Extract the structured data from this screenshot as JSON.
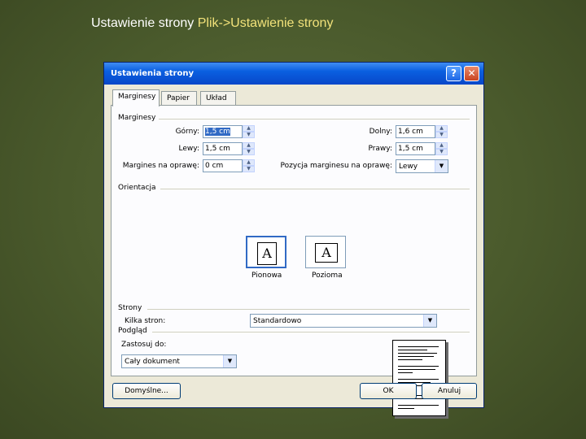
{
  "slide": {
    "title_plain": "Ustawienie strony ",
    "title_highlight": "Plik->Ustawienie strony"
  },
  "dialog": {
    "title": "Ustawienia strony",
    "help_glyph": "?",
    "close_glyph": "✕",
    "tabs": [
      {
        "label": "Marginesy",
        "active": true
      },
      {
        "label": "Papier",
        "active": false
      },
      {
        "label": "Układ",
        "active": false
      }
    ],
    "margins": {
      "group_label": "Marginesy",
      "top_label": "Górny:",
      "top_value": "1,5 cm",
      "left_label": "Lewy:",
      "left_value": "1,5 cm",
      "gutter_label": "Margines na oprawę:",
      "gutter_value": "0 cm",
      "bottom_label": "Dolny:",
      "bottom_value": "1,6 cm",
      "right_label": "Prawy:",
      "right_value": "1,5 cm",
      "gutter_pos_label": "Pozycja marginesu na oprawę:",
      "gutter_pos_value": "Lewy"
    },
    "orientation": {
      "group_label": "Orientacja",
      "portrait_label": "Pionowa",
      "landscape_label": "Pozioma",
      "icon_letter": "A",
      "selected": "Pionowa"
    },
    "pages": {
      "group_label": "Strony",
      "multiple_label": "Kilka stron:",
      "multiple_value": "Standardowo"
    },
    "preview": {
      "group_label": "Podgląd",
      "apply_label": "Zastosuj do:",
      "apply_value": "Cały dokument"
    },
    "buttons": {
      "default": "Domyślne...",
      "ok": "OK",
      "cancel": "Anuluj"
    },
    "colors": {
      "titlebar": "#0a5fe0",
      "selection": "#316ac5",
      "dialog_bg": "#ece9d8"
    }
  }
}
